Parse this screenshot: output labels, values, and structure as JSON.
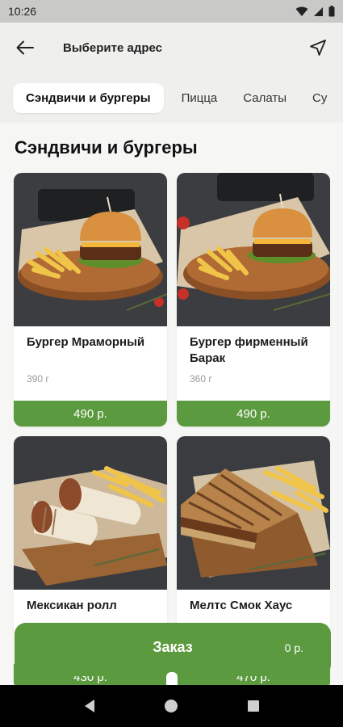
{
  "status_bar": {
    "time": "10:26"
  },
  "header": {
    "title": "Выберите адрес",
    "back_icon": "arrow-left-icon",
    "location_icon": "navigation-arrow-icon"
  },
  "tabs": [
    {
      "label": "Сэндвичи и бургеры",
      "active": true
    },
    {
      "label": "Пицца",
      "active": false
    },
    {
      "label": "Салаты",
      "active": false
    },
    {
      "label": "Су",
      "active": false
    }
  ],
  "section": {
    "title": "Сэндвичи и бургеры"
  },
  "products": [
    {
      "name": " Бургер Мраморный",
      "weight": "390 г",
      "price": "490 р.",
      "image": "burger-with-fries-photo"
    },
    {
      "name": "Бургер фирменный Барак",
      "weight": "360 г",
      "price": "490 р.",
      "image": "burger-with-fries-photo"
    },
    {
      "name": "Мексикан ролл",
      "price": "430 р.",
      "image": "wrap-roll-with-fries-photo"
    },
    {
      "name": "Мелтс Смок Хаус",
      "price": "470 р.",
      "image": "grilled-sandwich-with-fries-photo"
    }
  ],
  "order": {
    "label": "Заказ",
    "total": "0 р."
  },
  "colors": {
    "accent": "#5c9a3f",
    "background": "#f6f6f5",
    "bar": "#efefed"
  }
}
